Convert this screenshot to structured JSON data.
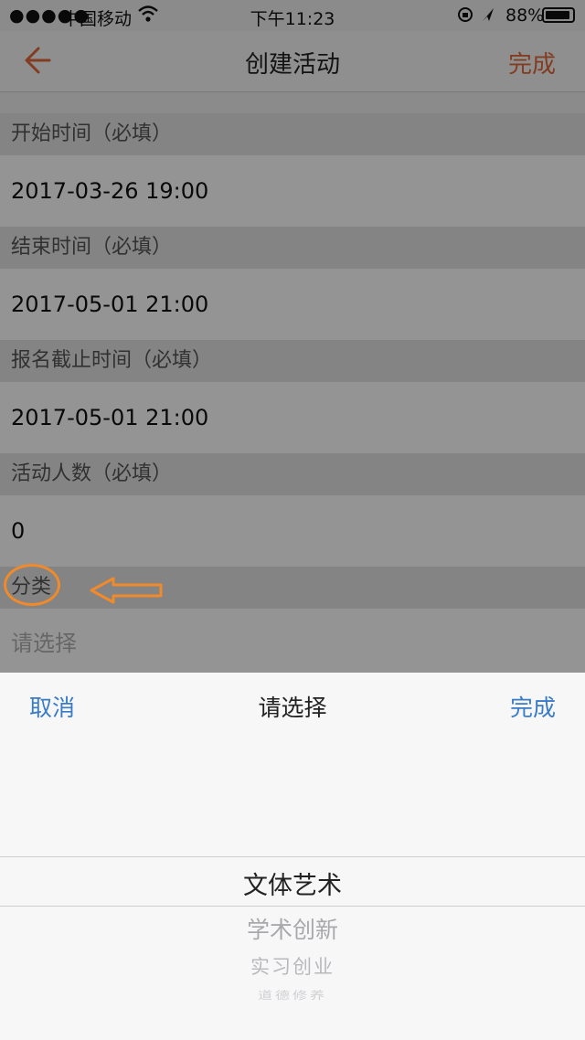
{
  "status_bar": {
    "signal": "●●●●●",
    "carrier": "中国移动",
    "time": "下午11:23",
    "battery": "88%"
  },
  "nav": {
    "title": "创建活动",
    "done_label": "完成"
  },
  "form": {
    "fields": [
      {
        "label": "开始时间（必填）",
        "value": "2017-03-26 19:00"
      },
      {
        "label": "结束时间（必填）",
        "value": "2017-05-01 21:00"
      },
      {
        "label": "报名截止时间（必填）",
        "value": "2017-05-01 21:00"
      },
      {
        "label": "活动人数（必填）",
        "value": "0"
      },
      {
        "label": "分类",
        "placeholder": "请选择"
      }
    ]
  },
  "picker": {
    "cancel_label": "取消",
    "title": "请选择",
    "done_label": "完成",
    "options": [
      "文体艺术",
      "学术创新",
      "实习创业",
      "道德修养"
    ],
    "selected_index": 0
  },
  "colors": {
    "accent": "#e0683a",
    "picker_accent": "#3a7bc8",
    "annotation": "#f08a2a"
  },
  "icons": {
    "back": "arrow-left-icon",
    "wifi": "wifi-icon",
    "annotation": "arrow-left-outline-icon"
  }
}
